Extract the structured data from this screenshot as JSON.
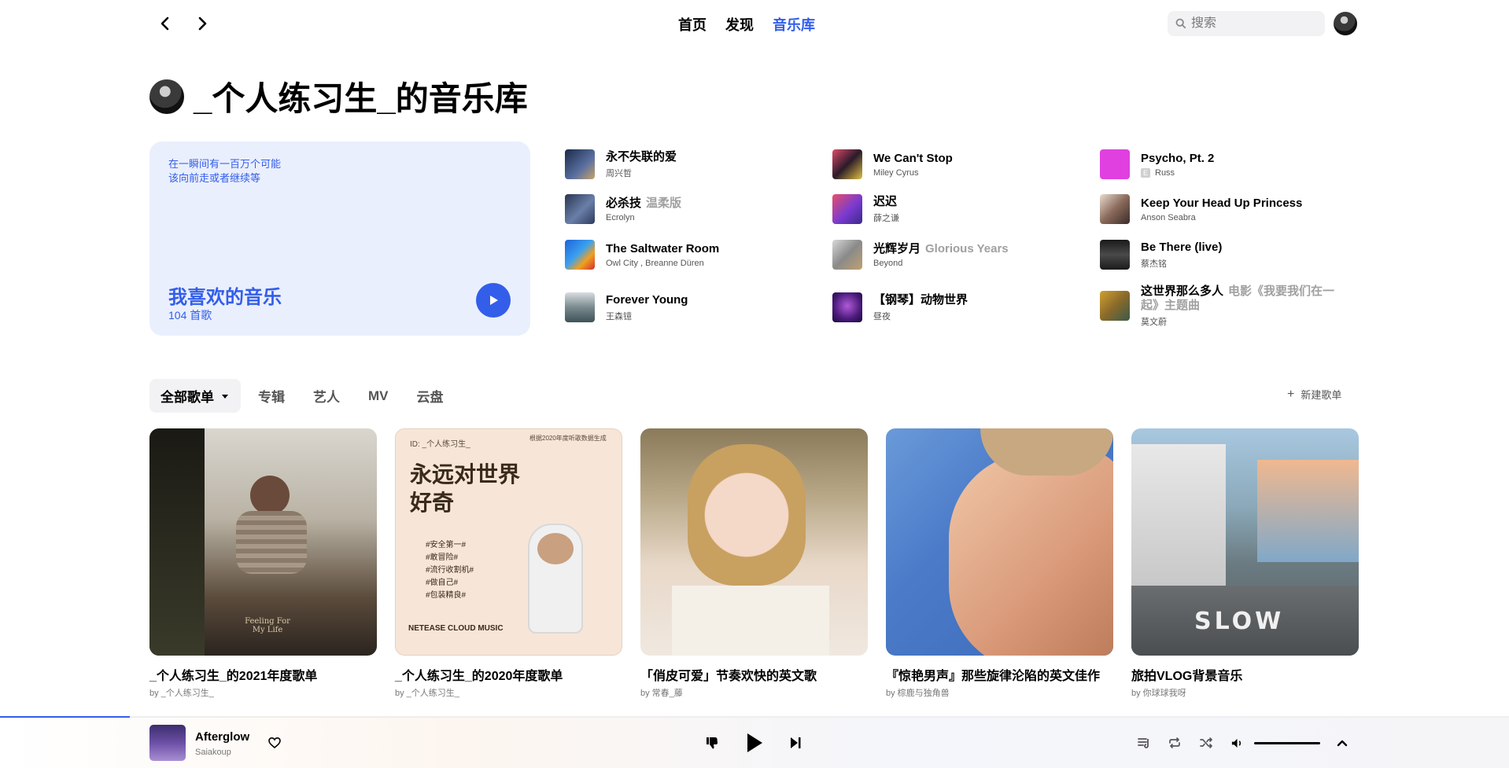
{
  "nav": {
    "back_label": "back",
    "forward_label": "forward",
    "links": [
      {
        "label": "首页",
        "active": false
      },
      {
        "label": "发现",
        "active": false
      },
      {
        "label": "音乐库",
        "active": true
      }
    ],
    "search_placeholder": "搜索",
    "accent": "#335eea"
  },
  "library": {
    "title": "_个人练习生_的音乐库"
  },
  "liked": {
    "lyric_line1": "在一瞬间有一百万个可能",
    "lyric_line2": "该向前走或者继续等",
    "name": "我喜欢的音乐",
    "count": "104 首歌"
  },
  "songs": [
    {
      "name": "永不失联的爱",
      "sub": "",
      "artist": "周兴哲",
      "explicit": false
    },
    {
      "name": "必杀技",
      "sub": "温柔版",
      "artist": "Ecrolyn",
      "explicit": false
    },
    {
      "name": "The Saltwater Room",
      "sub": "",
      "artist": "Owl City , Breanne Düren",
      "explicit": false
    },
    {
      "name": "Forever Young",
      "sub": "",
      "artist": "王森镱",
      "explicit": false
    },
    {
      "name": "We Can't Stop",
      "sub": "",
      "artist": "Miley Cyrus",
      "explicit": false
    },
    {
      "name": "迟迟",
      "sub": "",
      "artist": "薛之谦",
      "explicit": false
    },
    {
      "name": "光辉岁月",
      "sub": "Glorious Years",
      "artist": "Beyond",
      "explicit": false
    },
    {
      "name": "【钢琴】动物世界",
      "sub": "",
      "artist": "昼夜",
      "explicit": false
    },
    {
      "name": "Psycho, Pt. 2",
      "sub": "",
      "artist": "Russ",
      "explicit": true
    },
    {
      "name": "Keep Your Head Up Princess",
      "sub": "",
      "artist": "Anson Seabra",
      "explicit": false
    },
    {
      "name": "Be There (live)",
      "sub": "",
      "artist": "蔡杰铭",
      "explicit": false
    },
    {
      "name": "这世界那么多人",
      "sub": "电影《我要我们在一起》主题曲",
      "artist": "莫文蔚",
      "explicit": false
    }
  ],
  "tabs": [
    {
      "label": "全部歌单",
      "active": true
    },
    {
      "label": "专辑",
      "active": false
    },
    {
      "label": "艺人",
      "active": false
    },
    {
      "label": "MV",
      "active": false
    },
    {
      "label": "云盘",
      "active": false
    }
  ],
  "new_playlist_label": "新建歌单",
  "playlists": [
    {
      "title": "_个人练习生_的2021年度歌单",
      "by": "by _个人练习生_",
      "cover_text_1": "Feeling For",
      "cover_text_2": "My Life"
    },
    {
      "title": "_个人练习生_的2020年度歌单",
      "by": "by _个人练习生_",
      "cover_id": "ID: _个人练习生_",
      "cover_corner": "根据2020年度听歌数据生成",
      "cover_big": "永远对世界好奇",
      "cover_tags": [
        "#安全第一#",
        "#敢冒险#",
        "#流行收割机#",
        "#做自己#",
        "#包装精良#"
      ],
      "cover_brand": "NETEASE CLOUD MUSIC"
    },
    {
      "title": "「俏皮可爱」节奏欢快的英文歌",
      "by": "by 常春_藤"
    },
    {
      "title": "『惊艳男声』那些旋律沦陷的英文佳作",
      "by": "by 棕鹿与独角兽"
    },
    {
      "title": "旅拍VLOG背景音乐",
      "by": "by 你球球我呀",
      "cover_road": "SLOW"
    }
  ],
  "player": {
    "title": "Afterglow",
    "artist": "Saiakoup",
    "progress_fraction": 0.086
  }
}
